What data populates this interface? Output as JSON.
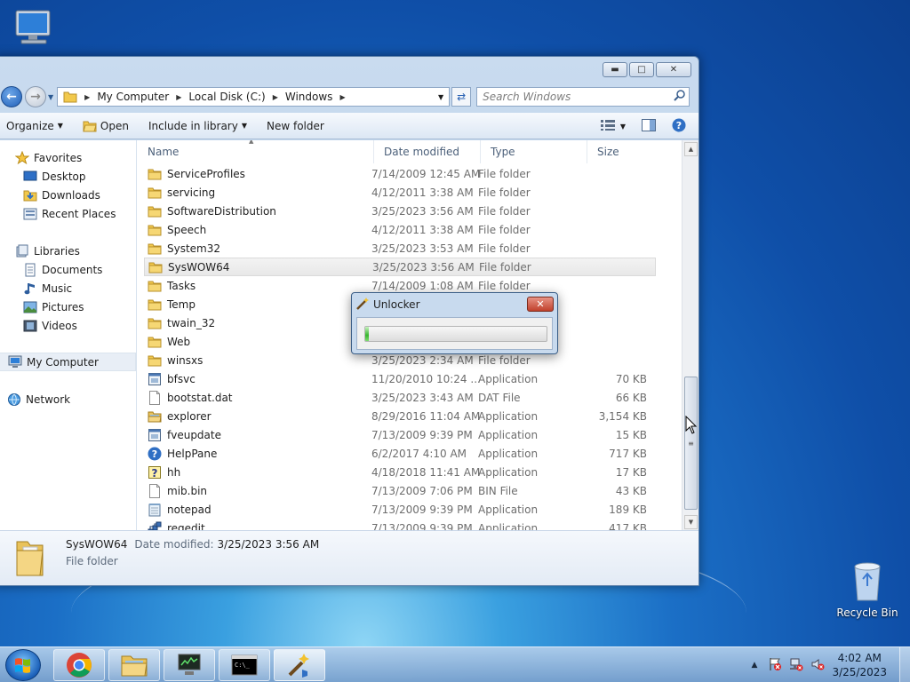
{
  "window": {
    "address_path": [
      "My Computer",
      "Local Disk (C:)",
      "Windows"
    ],
    "search_placeholder": "Search Windows"
  },
  "toolbar": {
    "organize": "Organize",
    "open": "Open",
    "include_in_library": "Include in library",
    "new_folder": "New folder"
  },
  "navpane": {
    "favorites": "Favorites",
    "desktop": "Desktop",
    "downloads": "Downloads",
    "recent_places": "Recent Places",
    "libraries": "Libraries",
    "documents": "Documents",
    "music": "Music",
    "pictures": "Pictures",
    "videos": "Videos",
    "my_computer": "My Computer",
    "network": "Network"
  },
  "columns": {
    "name": "Name",
    "date_modified": "Date modified",
    "type": "Type",
    "size": "Size"
  },
  "files": [
    {
      "name": "ServiceProfiles",
      "date": "7/14/2009 12:45 AM",
      "type": "File folder",
      "size": "",
      "icon": "folder-icon"
    },
    {
      "name": "servicing",
      "date": "4/12/2011 3:38 AM",
      "type": "File folder",
      "size": "",
      "icon": "folder-icon"
    },
    {
      "name": "SoftwareDistribution",
      "date": "3/25/2023 3:56 AM",
      "type": "File folder",
      "size": "",
      "icon": "folder-icon"
    },
    {
      "name": "Speech",
      "date": "4/12/2011 3:38 AM",
      "type": "File folder",
      "size": "",
      "icon": "folder-icon"
    },
    {
      "name": "System32",
      "date": "3/25/2023 3:53 AM",
      "type": "File folder",
      "size": "",
      "icon": "folder-icon"
    },
    {
      "name": "SysWOW64",
      "date": "3/25/2023 3:56 AM",
      "type": "File folder",
      "size": "",
      "icon": "folder-icon"
    },
    {
      "name": "Tasks",
      "date": "7/14/2009 1:08 AM",
      "type": "File folder",
      "size": "",
      "icon": "folder-icon"
    },
    {
      "name": "Temp",
      "date": "",
      "type": "",
      "size": "",
      "icon": "folder-icon"
    },
    {
      "name": "twain_32",
      "date": "",
      "type": "",
      "size": "",
      "icon": "folder-icon"
    },
    {
      "name": "Web",
      "date": "",
      "type": "",
      "size": "",
      "icon": "folder-icon"
    },
    {
      "name": "winsxs",
      "date": "3/25/2023 2:34 AM",
      "type": "File folder",
      "size": "",
      "icon": "folder-icon"
    },
    {
      "name": "bfsvc",
      "date": "11/20/2010 10:24 ...",
      "type": "Application",
      "size": "70 KB",
      "icon": "application-icon"
    },
    {
      "name": "bootstat.dat",
      "date": "3/25/2023 3:43 AM",
      "type": "DAT File",
      "size": "66 KB",
      "icon": "file-icon"
    },
    {
      "name": "explorer",
      "date": "8/29/2016 11:04 AM",
      "type": "Application",
      "size": "3,154 KB",
      "icon": "explorer-folder-icon"
    },
    {
      "name": "fveupdate",
      "date": "7/13/2009 9:39 PM",
      "type": "Application",
      "size": "15 KB",
      "icon": "application-icon"
    },
    {
      "name": "HelpPane",
      "date": "6/2/2017 4:10 AM",
      "type": "Application",
      "size": "717 KB",
      "icon": "help-icon"
    },
    {
      "name": "hh",
      "date": "4/18/2018 11:41 AM",
      "type": "Application",
      "size": "17 KB",
      "icon": "help-file-icon"
    },
    {
      "name": "mib.bin",
      "date": "7/13/2009 7:06 PM",
      "type": "BIN File",
      "size": "43 KB",
      "icon": "file-icon"
    },
    {
      "name": "notepad",
      "date": "7/13/2009 9:39 PM",
      "type": "Application",
      "size": "189 KB",
      "icon": "notepad-icon"
    },
    {
      "name": "regedit",
      "date": "7/13/2009 9:39 PM",
      "type": "Application",
      "size": "417 KB",
      "icon": "regedit-icon"
    }
  ],
  "selected_index": 5,
  "details": {
    "name": "SysWOW64",
    "date_label": "Date modified:",
    "date_value": "3/25/2023 3:56 AM",
    "type": "File folder"
  },
  "dialog": {
    "title": "Unlocker",
    "progress": 0.02
  },
  "desktop": {
    "recycle_bin": "Recycle Bin"
  },
  "clock": {
    "time": "4:02 AM",
    "date": "3/25/2023"
  }
}
